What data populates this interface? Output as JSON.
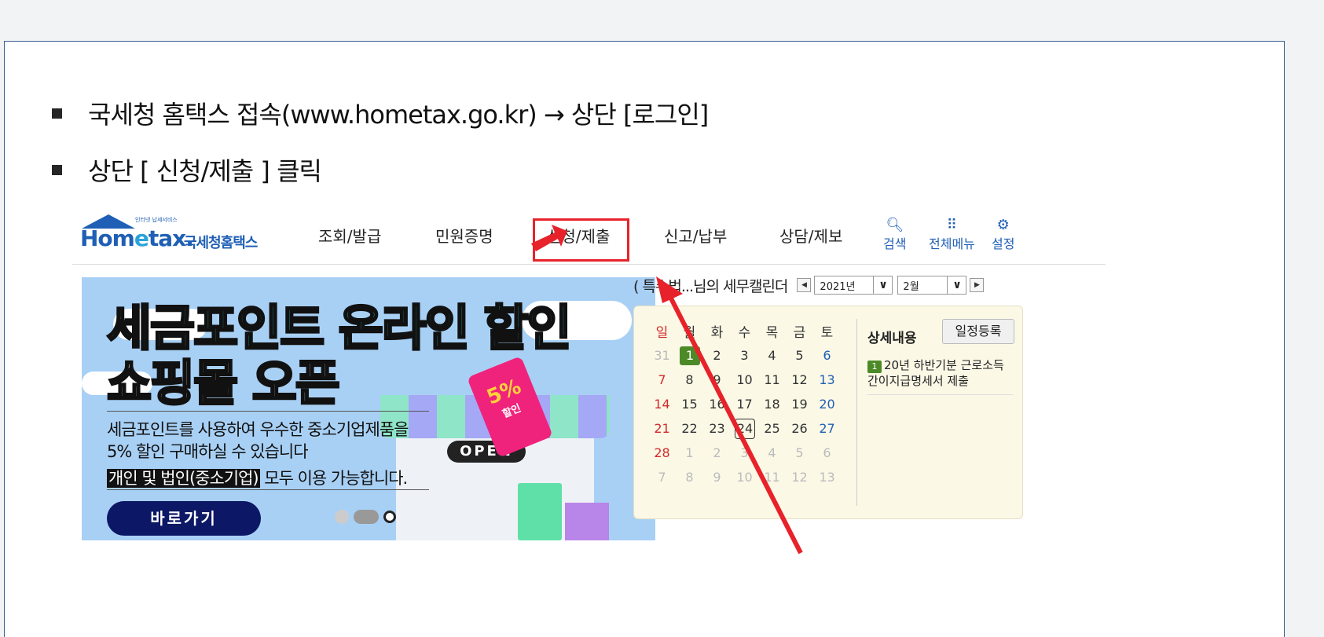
{
  "bullets": [
    {
      "text": "국세청 홈택스 접속(www.hometax.go.kr) → 상단 [로그인]"
    },
    {
      "text": "상단 [ 신청/제출 ] 클릭"
    }
  ],
  "hometax": {
    "logo": {
      "small": "인터넷 납세서비스",
      "brand_a": "Hom",
      "brand_e": "e",
      "brand_b": "tax.",
      "kr": "국세청홈택스"
    },
    "nav": [
      {
        "label": "조회/발급"
      },
      {
        "label": "민원증명"
      },
      {
        "label": "신청/제출"
      },
      {
        "label": "신고/납부"
      },
      {
        "label": "상담/제보"
      }
    ],
    "tools": [
      {
        "label": "검색",
        "icon": "search-icon"
      },
      {
        "label": "전체메뉴",
        "icon": "grid-menu-icon"
      },
      {
        "label": "설정",
        "icon": "gear-icon"
      }
    ],
    "banner": {
      "headline1": "세금포인트 온라인 할인",
      "headline2": "쇼핑몰 오픈",
      "desc1": "세금포인트를 사용하여 우수한 중소기업제품을",
      "desc2": "5% 할인 구매하실 수 있습니다",
      "desc3_highlight": "개인 및 법인(중소기업)",
      "desc3_rest": " 모두 이용 가능합니다.",
      "button": "바로가기",
      "tag_percent": "5%",
      "tag_label": "할인",
      "open_sign": "OPEN"
    },
    "calendar": {
      "title": "( 특수법...님의 세무캘린더",
      "year": "2021년",
      "month": "2월",
      "weekdays": [
        "일",
        "월",
        "화",
        "수",
        "목",
        "금",
        "토"
      ],
      "weeks": [
        [
          "31",
          "1",
          "2",
          "3",
          "4",
          "5",
          "6"
        ],
        [
          "7",
          "8",
          "9",
          "10",
          "11",
          "12",
          "13"
        ],
        [
          "14",
          "15",
          "16",
          "17",
          "18",
          "19",
          "20"
        ],
        [
          "21",
          "22",
          "23",
          "24",
          "25",
          "26",
          "27"
        ],
        [
          "28",
          "1",
          "2",
          "3",
          "4",
          "5",
          "6"
        ],
        [
          "7",
          "8",
          "9",
          "10",
          "11",
          "12",
          "13"
        ]
      ],
      "detail_title": "상세내용",
      "register_button": "일정등록",
      "event_badge": "1",
      "event_text": "20년 하반기분 근로소득 간이지급명세서 제출"
    }
  },
  "colors": {
    "accent_red": "#e8222a",
    "brand_blue": "#1f5fb5",
    "cal_green": "#4c8a28"
  }
}
